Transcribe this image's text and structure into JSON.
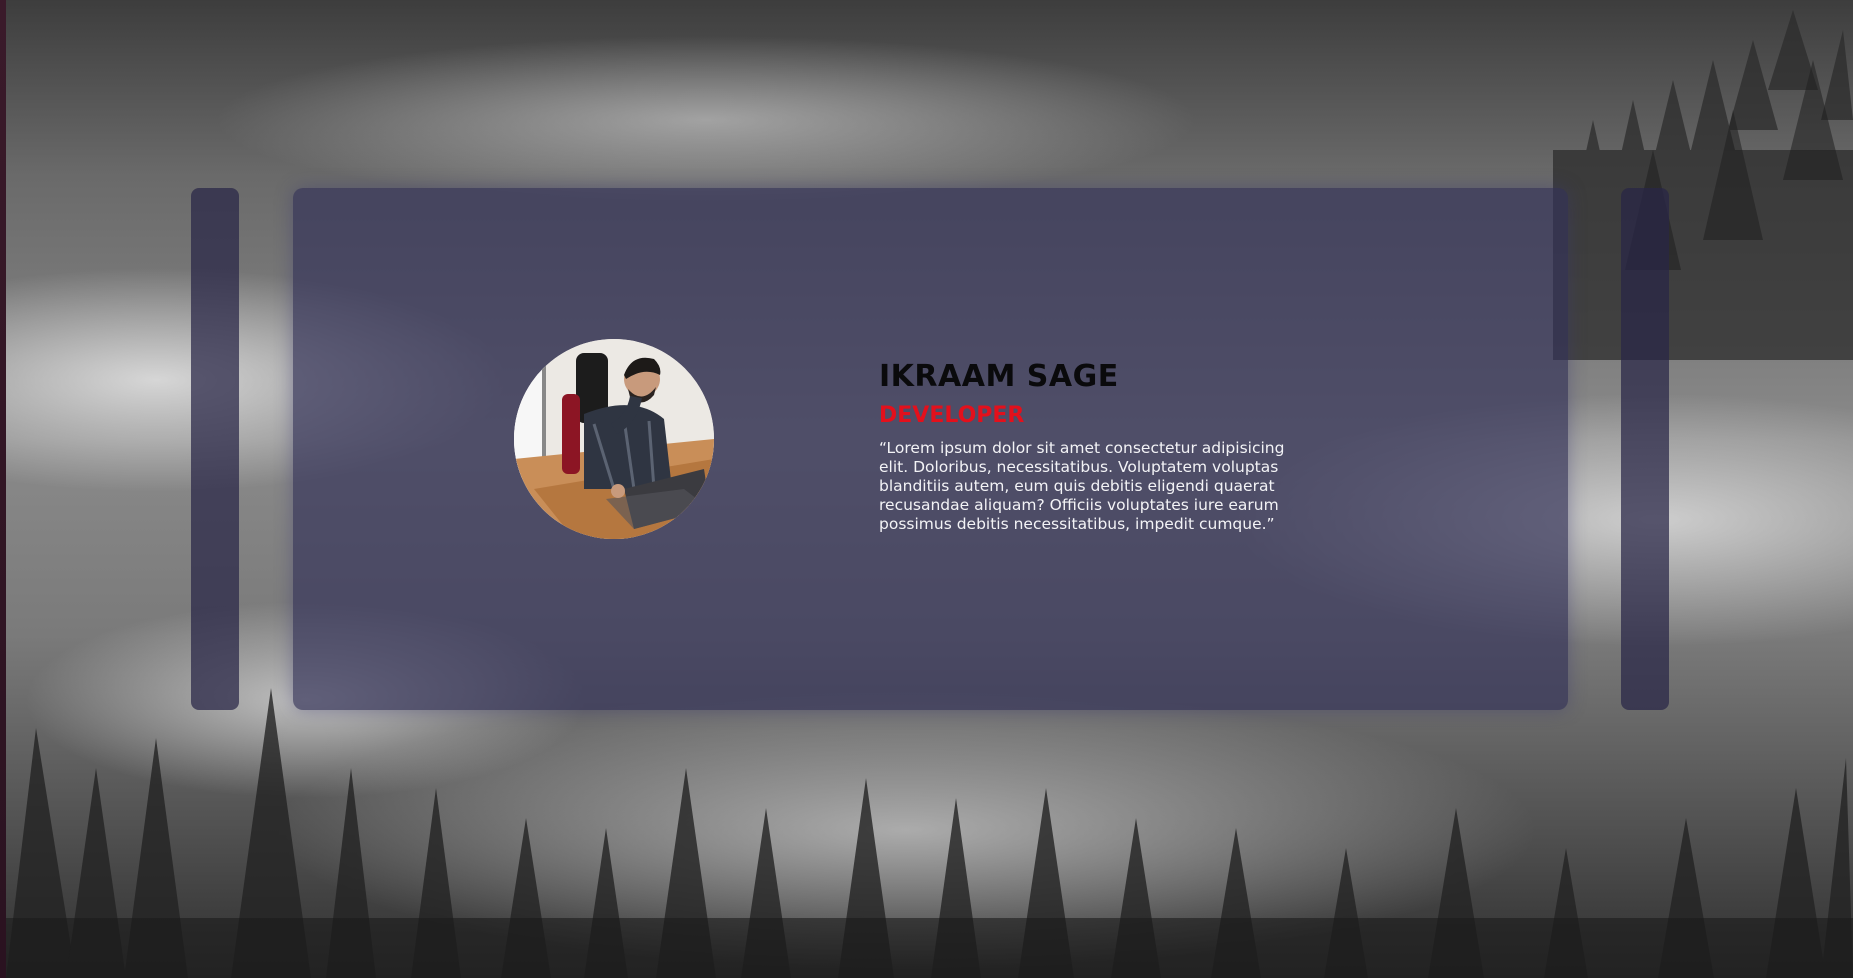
{
  "testimonial": {
    "name": "IKRAAM SAGE",
    "role": "DEVELOPER",
    "quote": "“Lorem ipsum dolor sit amet consectetur adipisicing elit. Doloribus, necessitatibus. Voluptatem voluptas blanditiis autem, eum quis debitis eligendi quaerat recusandae aliquam? Officiis voluptates iure earum possimus debitis necessitatibus, impedit cumque.”"
  },
  "colors": {
    "card_background": "#343258",
    "name_color": "#0a0a0c",
    "role_color": "#e3101c",
    "quote_color": "#f3f3f6"
  },
  "icons": {
    "avatar": "person-at-laptop-photo"
  }
}
